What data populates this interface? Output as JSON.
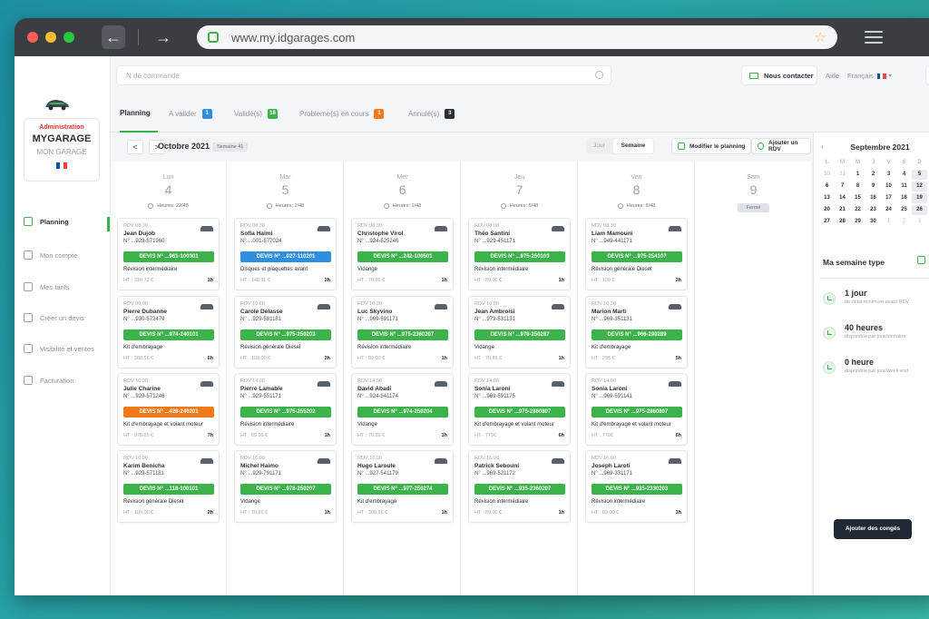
{
  "browser": {
    "url": "www.my.idgarages.com"
  },
  "brand": {
    "admin": "Administration",
    "name": "MYGARAGE",
    "sub": "MON GARAGE",
    "colors": {
      "blue": "#0055a4",
      "white": "#ffffff",
      "red": "#ef4135"
    }
  },
  "sidebar": {
    "items": [
      {
        "label": "Planning",
        "icon": "calendar-icon"
      },
      {
        "label": "Mon compte",
        "icon": "user-icon"
      },
      {
        "label": "Mes tarifs",
        "icon": "tag-icon"
      },
      {
        "label": "Créer un devis",
        "icon": "document-icon"
      },
      {
        "label": "Visibilité et ventes",
        "icon": "bar-chart-icon"
      },
      {
        "label": "Facturation",
        "icon": "arrows-icon"
      }
    ]
  },
  "topbar": {
    "search_placeholder": "N de commande",
    "contact": "Nous contacter",
    "aide": "Aide",
    "lang": "Français"
  },
  "tabs": [
    {
      "label": "Planning",
      "badge": ""
    },
    {
      "label": "A valider",
      "badge": "1",
      "color": "#2e8fe0"
    },
    {
      "label": "Validé(s)",
      "badge": "18",
      "color": "#3cb34a"
    },
    {
      "label": "Probleme(s) en cours",
      "badge": "1",
      "color": "#f07a1a"
    },
    {
      "label": "Annulé(s)",
      "badge": "3",
      "color": "#2b2f36"
    }
  ],
  "toolbar": {
    "prev": "<",
    "next": ">",
    "month": "Octobre 2021",
    "week": "Semaine 41",
    "jour": "Jour",
    "semaine": "Semaine",
    "modifier": "Modifier le planning",
    "ajouter": "Ajouter un RDV"
  },
  "days": [
    {
      "name": "Lun",
      "num": "4",
      "hours": "Heures: 22/48",
      "cards": [
        {
          "rdv": "RDV 08:30",
          "name": "Jean Dujob",
          "tel": "N° ...929-571960",
          "devis": "DEVIS N° ...961-100301",
          "status": "green",
          "desc": "Révision intermédiaire",
          "ht": "HT : 319.72 €",
          "dur": "1h"
        },
        {
          "rdv": "RDV 09:00",
          "name": "Pierre Dubanne",
          "tel": "N° ...930-572479",
          "devis": "DEVIS N° ...974-240101",
          "status": "green",
          "desc": "Kit d'embrayage",
          "ht": "HT : 308.56 €",
          "dur": "6h"
        },
        {
          "rdv": "RDV 10:00",
          "name": "Julie Charine",
          "tel": "N° ...929-571246",
          "devis": "DEVIS N° ...426-240201",
          "status": "orange",
          "desc": "Kit d'embrayage et volant moteur",
          "ht": "HT : 978.65 €",
          "dur": "7h"
        },
        {
          "rdv": "RDV 10:00",
          "name": "Karim Benicha",
          "tel": "N° ...929-571181",
          "devis": "DEVIS N° ...118-100101",
          "status": "green",
          "desc": "Révision générale Diesel",
          "ht": "HT : 109.00 €",
          "dur": "2h"
        }
      ]
    },
    {
      "name": "Mar",
      "num": "5",
      "hours": "Heures: 2/48",
      "cards": [
        {
          "rdv": "RDV 08:30",
          "name": "Sofia Haimi",
          "tel": "N° ...001-577024",
          "devis": "DEVIS N° ...027-110201",
          "status": "blue",
          "desc": "Disques et plaquettes avant",
          "ht": "HT : 148.11 €",
          "dur": "2h"
        },
        {
          "rdv": "RDV 10:00",
          "name": "Carole Delasse",
          "tel": "N° ...929-581181",
          "devis": "DEVIS N° ...975-250203",
          "status": "green",
          "desc": "Révision générale Diesel",
          "ht": "HT : 109.00 €",
          "dur": "2h"
        },
        {
          "rdv": "RDV 14:00",
          "name": "Pierre Lamable",
          "tel": "N° ...929-551171",
          "devis": "DEVIS N° ...975-255202",
          "status": "green",
          "desc": "Révision intermédiaire",
          "ht": "HT : 89.00 €",
          "dur": "1h"
        },
        {
          "rdv": "RDV 16:00",
          "name": "Michel Haimo",
          "tel": "N° ...929-791171",
          "devis": "DEVIS N° ...978-250207",
          "status": "green",
          "desc": "Vidange",
          "ht": "HT : 70.85 €",
          "dur": "1h"
        }
      ]
    },
    {
      "name": "Mer",
      "num": "6",
      "hours": "Heures: 1/48",
      "cards": [
        {
          "rdv": "RDV 08:30",
          "name": "Christophe Virol",
          "tel": "N° ...924-525246",
          "devis": "DEVIS N° ...242-100501",
          "status": "green",
          "desc": "Vidange",
          "ht": "HT : 70.85 €",
          "dur": "1h"
        },
        {
          "rdv": "RDV 10:30",
          "name": "Luc Skyvino",
          "tel": "N° ...969-591171",
          "devis": "DEVIS N° ...975-2360207",
          "status": "green",
          "desc": "Révision intermédiaire",
          "ht": "HT : 89.00 €",
          "dur": "1h"
        },
        {
          "rdv": "RDV 14:00",
          "name": "David Abadi",
          "tel": "N° ...924-541174",
          "devis": "DEVIS N° ...974-250204",
          "status": "green",
          "desc": "Vidange",
          "ht": "HT : 70.85 €",
          "dur": "1h"
        },
        {
          "rdv": "RDV 16:00",
          "name": "Hugo Laroule",
          "tel": "N° ...927-541179",
          "devis": "DEVIS N° ...977-250274",
          "status": "green",
          "desc": "Kit d'embrayage",
          "ht": "HT : 308.56 €",
          "dur": "1h"
        }
      ]
    },
    {
      "name": "Jeu",
      "num": "7",
      "hours": "Heures: 6/48",
      "cards": [
        {
          "rdv": "RDV 08:00",
          "name": "Théo Santini",
          "tel": "N° ...929-451171",
          "devis": "DEVIS N° ...975-250103",
          "status": "green",
          "desc": "Révision intermédiaire",
          "ht": "HT : 89.00 €",
          "dur": "1h"
        },
        {
          "rdv": "RDV 10:00",
          "name": "Jean Ambroisi",
          "tel": "N° ...979-531131",
          "devis": "DEVIS N° ...978-250287",
          "status": "green",
          "desc": "Vidange",
          "ht": "HT : 70.85 €",
          "dur": "1h"
        },
        {
          "rdv": "RDV 14:00",
          "name": "Sonia Laroni",
          "tel": "N° ...969-591175",
          "devis": "DEVIS N° ...975-2860807",
          "status": "green",
          "desc": "Kit d'embrayage et volant moteur",
          "ht": "HT : 779€",
          "dur": "6h"
        },
        {
          "rdv": "RDV 16:00",
          "name": "Patrick Sebouni",
          "tel": "N° ...969-521172",
          "devis": "DEVIS N° ...935-2360207",
          "status": "green",
          "desc": "Révision intermédiaire",
          "ht": "HT : 89.00 €",
          "dur": "1h"
        }
      ]
    },
    {
      "name": "Ven",
      "num": "8",
      "hours": "Heures: 6/48",
      "cards": [
        {
          "rdv": "RDV 08:30",
          "name": "Liam Mamouni",
          "tel": "N° ...949-441171",
          "devis": "DEVIS N° ...975-254107",
          "status": "green",
          "desc": "Révision générale Diesel",
          "ht": "HT : 109 €",
          "dur": "2h"
        },
        {
          "rdv": "RDV 10:30",
          "name": "Marion Marti",
          "tel": "N° ...969-351131",
          "devis": "DEVIS N° ...966-290289",
          "status": "green",
          "desc": "Kit d'embrayage",
          "ht": "HT : 295 €",
          "dur": "5h"
        },
        {
          "rdv": "RDV 14:00",
          "name": "Sonia Laroni",
          "tel": "N° ...969-591141",
          "devis": "DEVIS N° ...975-2860807",
          "status": "green",
          "desc": "Kit d'embrayage et volant moteur",
          "ht": "HT : 779€",
          "dur": "6h"
        },
        {
          "rdv": "RDV 16:00",
          "name": "Joseph Laroti",
          "tel": "N° ...969-331171",
          "devis": "DEVIS N° ...935-2330203",
          "status": "green",
          "desc": "Révision intermédiaire",
          "ht": "HT : 89.00 €",
          "dur": "1h"
        }
      ]
    },
    {
      "name": "Sam",
      "num": "9",
      "closed": "Fermé",
      "cards": []
    }
  ],
  "calendar": {
    "month": "Septembre 2021",
    "weekdays": [
      "L",
      "M",
      "M",
      "J",
      "V",
      "S",
      "D"
    ],
    "weeks": [
      [
        [
          "30",
          "mute"
        ],
        [
          "31",
          "mute"
        ],
        [
          "1",
          ""
        ],
        [
          "2",
          ""
        ],
        [
          "3",
          ""
        ],
        [
          "4",
          ""
        ],
        [
          "5",
          "hl"
        ]
      ],
      [
        [
          "6",
          ""
        ],
        [
          "7",
          ""
        ],
        [
          "8",
          ""
        ],
        [
          "9",
          ""
        ],
        [
          "10",
          ""
        ],
        [
          "11",
          ""
        ],
        [
          "12",
          "hl"
        ]
      ],
      [
        [
          "13",
          ""
        ],
        [
          "14",
          ""
        ],
        [
          "15",
          ""
        ],
        [
          "16",
          ""
        ],
        [
          "17",
          ""
        ],
        [
          "18",
          ""
        ],
        [
          "19",
          "hl"
        ]
      ],
      [
        [
          "20",
          ""
        ],
        [
          "21",
          ""
        ],
        [
          "22",
          ""
        ],
        [
          "23",
          ""
        ],
        [
          "24",
          ""
        ],
        [
          "25",
          ""
        ],
        [
          "26",
          "hl"
        ]
      ],
      [
        [
          "27",
          ""
        ],
        [
          "28",
          ""
        ],
        [
          "29",
          ""
        ],
        [
          "30",
          ""
        ],
        [
          "1",
          "mute"
        ],
        [
          "2",
          "mute"
        ],
        [
          "3",
          "mute"
        ]
      ]
    ]
  },
  "semaine_type": {
    "title": "Ma semaine type",
    "stats": [
      {
        "value": "1 jour",
        "sub": "de délai minimum avant RDV"
      },
      {
        "value": "40 heures",
        "sub": "disponible par jour/semaine"
      },
      {
        "value": "0 heure",
        "sub": "disponible par jour/week-end"
      }
    ],
    "conges": "Ajouter des congés"
  },
  "status_colors": {
    "green": "#3cb34a",
    "orange": "#f07a1a",
    "blue": "#2e8fe0"
  }
}
